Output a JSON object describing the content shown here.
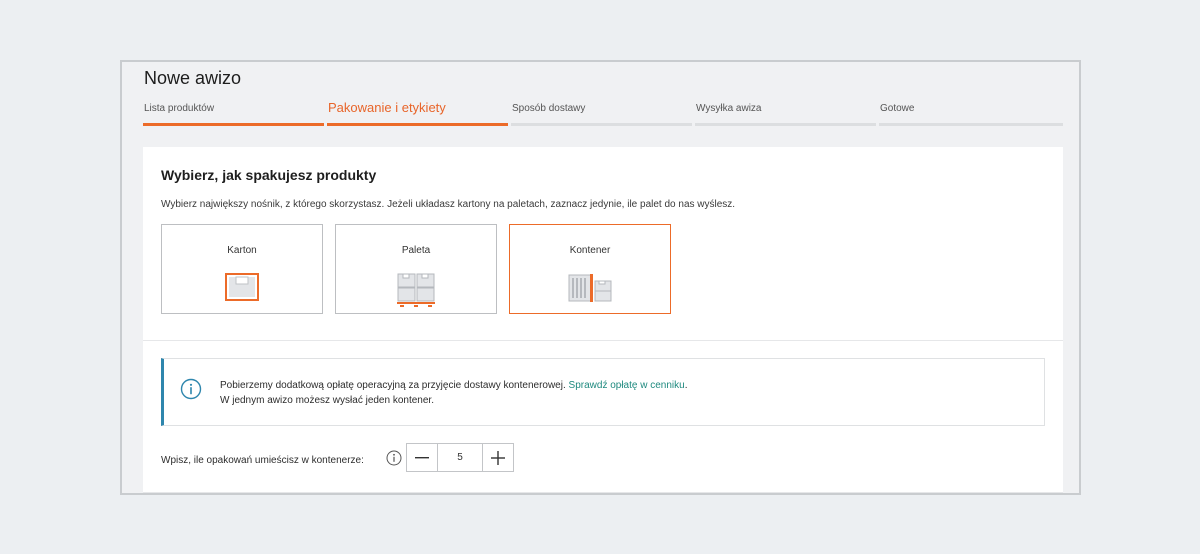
{
  "page": {
    "title": "Nowe awizo"
  },
  "stepper": {
    "steps": [
      {
        "label": "Lista produktów",
        "state": "done"
      },
      {
        "label": "Pakowanie i etykiety",
        "state": "active"
      },
      {
        "label": "Sposób dostawy",
        "state": "pending"
      },
      {
        "label": "Wysyłka awiza",
        "state": "pending"
      },
      {
        "label": "Gotowe",
        "state": "pending"
      }
    ]
  },
  "packing": {
    "title": "Wybierz, jak spakujesz produkty",
    "description": "Wybierz największy nośnik, z którego skorzystasz. Jeżeli układasz kartony na paletach, zaznacz jedynie, ile palet do nas wyślesz.",
    "options": [
      {
        "label": "Karton",
        "icon": "box-icon",
        "selected": false
      },
      {
        "label": "Paleta",
        "icon": "pallet-icon",
        "selected": false
      },
      {
        "label": "Kontener",
        "icon": "container-icon",
        "selected": true
      }
    ]
  },
  "info": {
    "line1": "Pobierzemy dodatkową opłatę operacyjną za przyjęcie dostawy kontenerowej.",
    "link": "Sprawdź opłatę w cenniku",
    "line1_end": ".",
    "line2": "W jednym awizo możesz wysłać jeden kontener."
  },
  "quantity": {
    "label": "Wpisz, ile opakowań umieścisz w kontenerze:",
    "value": "5",
    "minus_symbol": "—",
    "plus_symbol": "+"
  },
  "colors": {
    "accent": "#ec6b29",
    "info_border": "#2e86ad",
    "link": "#1f8a7f"
  }
}
